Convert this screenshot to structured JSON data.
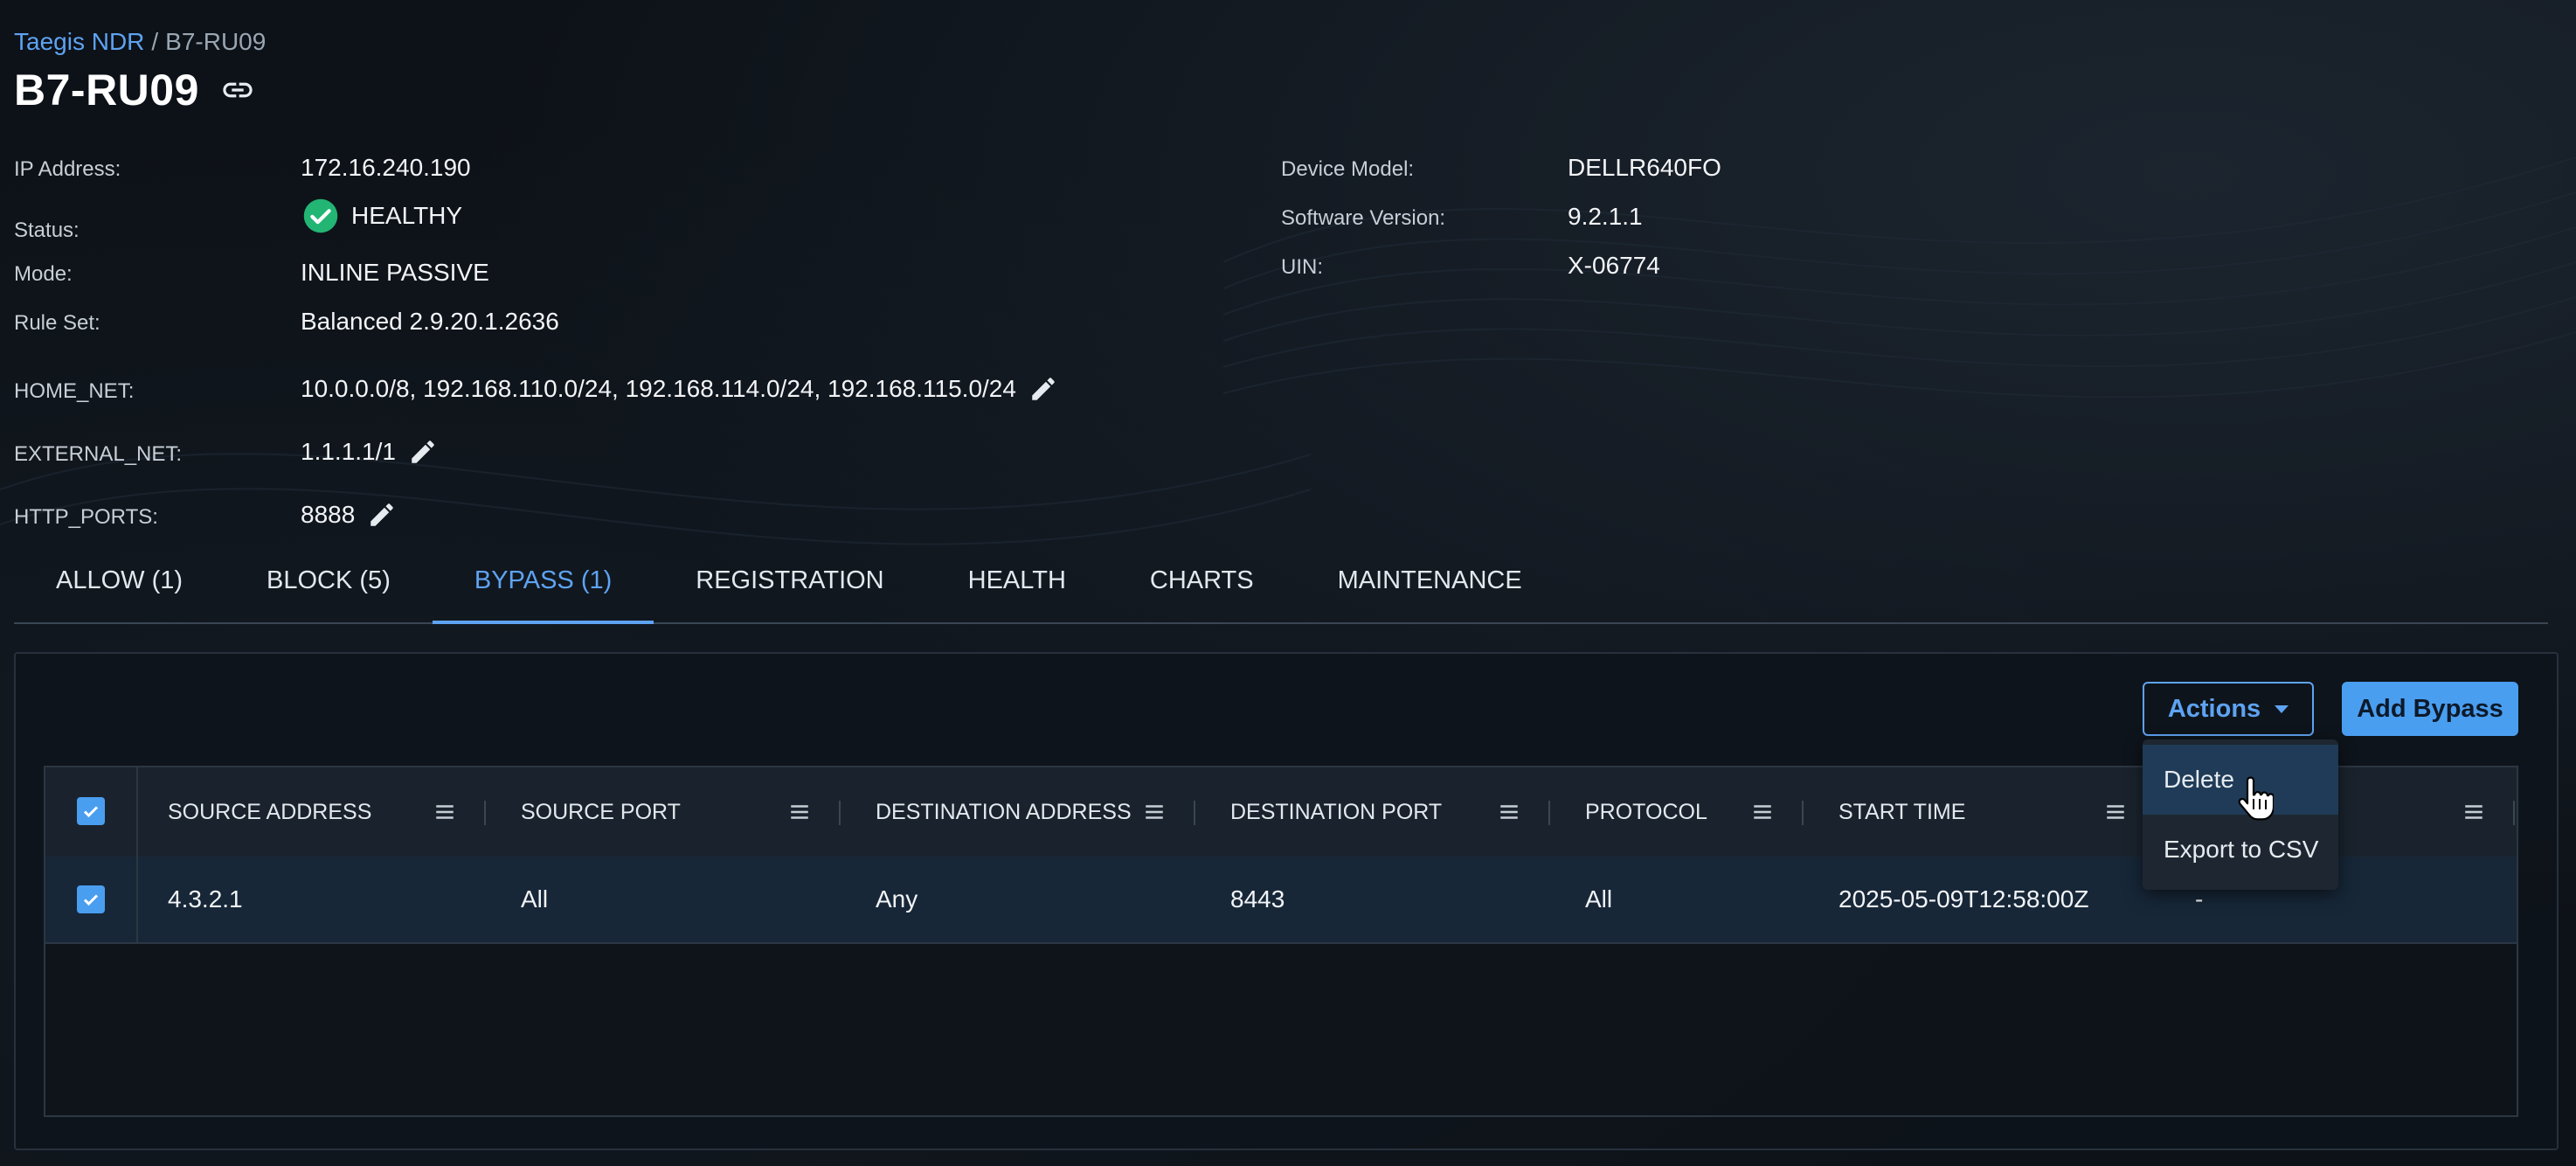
{
  "breadcrumb": {
    "root": "Taegis NDR",
    "separator": "/",
    "current": "B7-RU09"
  },
  "page": {
    "title": "B7-RU09"
  },
  "info": {
    "ip_label": "IP Address:",
    "ip_value": "172.16.240.190",
    "status_label": "Status:",
    "status_value": "HEALTHY",
    "mode_label": "Mode:",
    "mode_value": "INLINE PASSIVE",
    "ruleset_label": "Rule Set:",
    "ruleset_value": "Balanced 2.9.20.1.2636",
    "home_net_label": "HOME_NET:",
    "home_net_value": "10.0.0.0/8, 192.168.110.0/24, 192.168.114.0/24, 192.168.115.0/24",
    "external_net_label": "EXTERNAL_NET:",
    "external_net_value": "1.1.1.1/1",
    "http_ports_label": "HTTP_PORTS:",
    "http_ports_value": "8888",
    "model_label": "Device Model:",
    "model_value": "DELLR640FO",
    "software_label": "Software Version:",
    "software_value": "9.2.1.1",
    "uin_label": "UIN:",
    "uin_value": "X-06774"
  },
  "tabs": [
    {
      "label": "ALLOW (1)"
    },
    {
      "label": "BLOCK (5)"
    },
    {
      "label": "BYPASS (1)",
      "active": true
    },
    {
      "label": "REGISTRATION"
    },
    {
      "label": "HEALTH"
    },
    {
      "label": "CHARTS"
    },
    {
      "label": "MAINTENANCE"
    }
  ],
  "toolbar": {
    "actions_label": "Actions",
    "add_label": "Add Bypass"
  },
  "dropdown": {
    "items": [
      "Delete",
      "Export to CSV"
    ]
  },
  "table": {
    "columns": [
      "SOURCE ADDRESS",
      "SOURCE PORT",
      "DESTINATION ADDRESS",
      "DESTINATION PORT",
      "PROTOCOL",
      "START TIME",
      ""
    ],
    "rows": [
      {
        "selected": true,
        "cells": [
          "4.3.2.1",
          "All",
          "Any",
          "8443",
          "All",
          "2025-05-09T12:58:00Z",
          "-"
        ]
      }
    ]
  },
  "colors": {
    "accent": "#5ea3f2",
    "healthy": "#22b573",
    "background": "#0d1218"
  },
  "icons": {
    "link": "link-icon",
    "edit": "pencil-icon",
    "status": "check-circle-icon",
    "column_menu": "menu-lines-icon",
    "cursor": "hand-pointer-icon"
  }
}
